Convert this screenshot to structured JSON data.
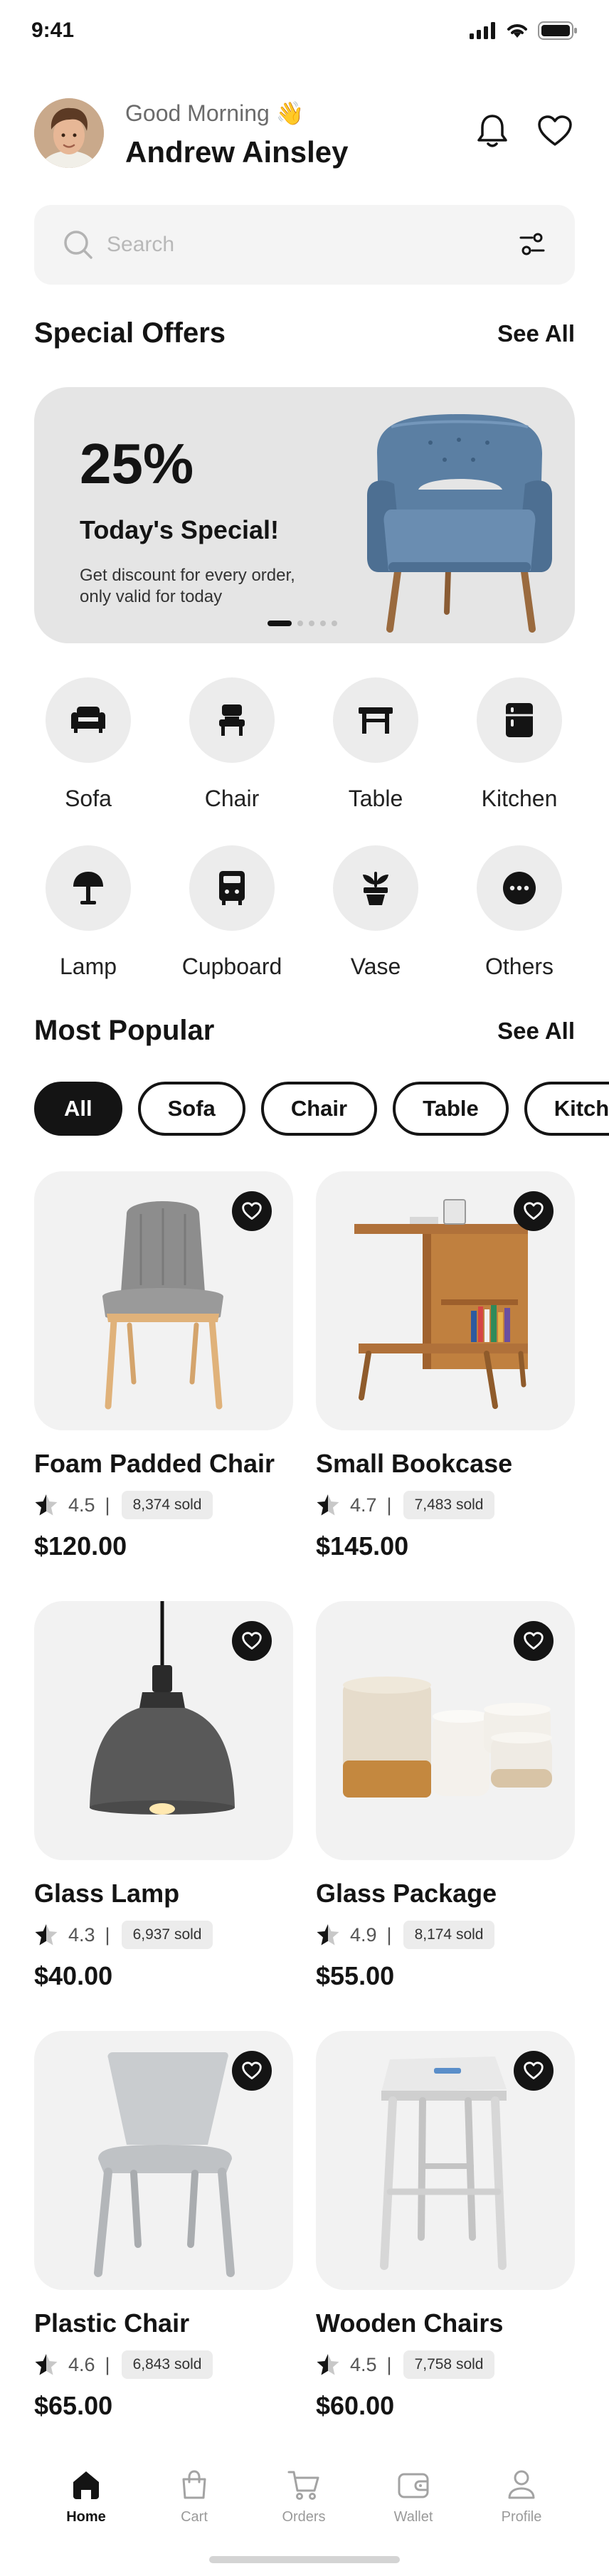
{
  "status_bar": {
    "time": "9:41"
  },
  "header": {
    "greeting": "Good Morning 👋",
    "user_name": "Andrew Ainsley"
  },
  "search": {
    "placeholder": "Search",
    "value": ""
  },
  "special_offers": {
    "title": "Special Offers",
    "see_all": "See All",
    "banner": {
      "discount": "25%",
      "title": "Today's Special!",
      "description": "Get discount for every order, only valid for today",
      "slide_count": 5,
      "active_slide": 1
    }
  },
  "categories": [
    {
      "label": "Sofa",
      "icon": "sofa-icon"
    },
    {
      "label": "Chair",
      "icon": "chair-icon"
    },
    {
      "label": "Table",
      "icon": "table-icon"
    },
    {
      "label": "Kitchen",
      "icon": "kitchen-icon"
    },
    {
      "label": "Lamp",
      "icon": "lamp-icon"
    },
    {
      "label": "Cupboard",
      "icon": "cupboard-icon"
    },
    {
      "label": "Vase",
      "icon": "vase-icon"
    },
    {
      "label": "Others",
      "icon": "more-icon"
    }
  ],
  "most_popular": {
    "title": "Most Popular",
    "see_all": "See All",
    "filters": [
      "All",
      "Sofa",
      "Chair",
      "Table",
      "Kitchen"
    ],
    "active_filter": "All"
  },
  "products": [
    {
      "name": "Foam Padded Chair",
      "rating": "4.5",
      "sold": "8,374 sold",
      "price": "$120.00"
    },
    {
      "name": "Small Bookcase",
      "rating": "4.7",
      "sold": "7,483 sold",
      "price": "$145.00"
    },
    {
      "name": "Glass Lamp",
      "rating": "4.3",
      "sold": "6,937 sold",
      "price": "$40.00"
    },
    {
      "name": "Glass Package",
      "rating": "4.9",
      "sold": "8,174 sold",
      "price": "$55.00"
    },
    {
      "name": "Plastic Chair",
      "rating": "4.6",
      "sold": "6,843 sold",
      "price": "$65.00"
    },
    {
      "name": "Wooden Chairs",
      "rating": "4.5",
      "sold": "7,758 sold",
      "price": "$60.00"
    }
  ],
  "bottom_nav": {
    "items": [
      {
        "label": "Home",
        "icon": "home-icon",
        "active": true
      },
      {
        "label": "Cart",
        "icon": "cart-bag-icon",
        "active": false
      },
      {
        "label": "Orders",
        "icon": "orders-cart-icon",
        "active": false
      },
      {
        "label": "Wallet",
        "icon": "wallet-icon",
        "active": false
      },
      {
        "label": "Profile",
        "icon": "profile-icon",
        "active": false
      }
    ]
  },
  "colors": {
    "primary": "#141414",
    "surface": "#f2f2f2",
    "muted_text": "#9a9a9a",
    "banner_bg": "#e5e5e5"
  }
}
